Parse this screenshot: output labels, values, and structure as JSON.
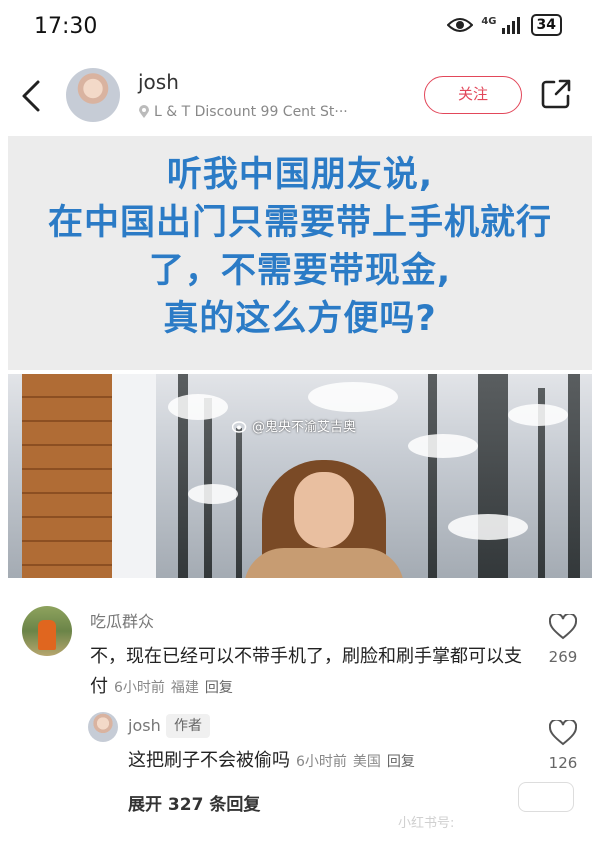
{
  "status": {
    "time": "17:30",
    "network": "4G",
    "battery": "34",
    "icons": [
      "eye-icon",
      "signal-icon",
      "battery-icon"
    ]
  },
  "header": {
    "username": "josh",
    "location": "L & T Discount 99 Cent St···",
    "follow_label": "关注",
    "icons": [
      "back-icon",
      "location-pin-icon",
      "share-icon"
    ]
  },
  "post": {
    "title_lines": [
      "听我中国朋友说,",
      "在中国出门只需要带上手机就行",
      "了，不需要带现金,",
      "真的这么方便吗?"
    ],
    "photo_watermark": "@鬼央不渝艾吉奥"
  },
  "comments": [
    {
      "username": "吃瓜群众",
      "text": "不，现在已经可以不带手机了，刷脸和刷手掌都可以支付",
      "time": "6小时前",
      "location": "福建",
      "reply_label": "回复",
      "likes": "269"
    },
    {
      "username": "josh",
      "badge": "作者",
      "text": "这把刷子不会被偷吗",
      "time": "6小时前",
      "location": "美国",
      "reply_label": "回复",
      "likes": "126"
    }
  ],
  "expand_label": "展开 327 条回复",
  "bottom_watermark": "小红书号:",
  "colors": {
    "accent": "#e2475a",
    "title_blue": "#2b7bc6",
    "title_bg": "#ececec"
  }
}
